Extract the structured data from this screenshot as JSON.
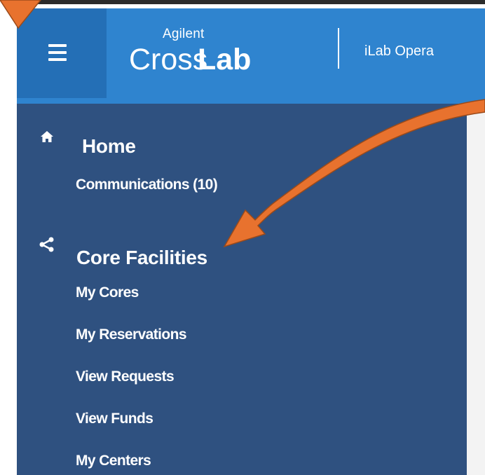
{
  "header": {
    "brand_small": "Agilent",
    "brand_cross": "Cross",
    "brand_lab": "Lab",
    "app_title": "iLab Opera"
  },
  "sidebar": {
    "home": {
      "icon": "home-icon",
      "title": "Home",
      "items": [
        {
          "label": "Communications (10)"
        }
      ]
    },
    "core_facilities": {
      "icon": "share-icon",
      "title": "Core Facilities",
      "items": [
        {
          "label": "My Cores"
        },
        {
          "label": "My Reservations"
        },
        {
          "label": "View Requests"
        },
        {
          "label": "View Funds"
        },
        {
          "label": "My Centers"
        }
      ]
    }
  },
  "colors": {
    "header_bg": "#2f84cf",
    "menu_button_bg": "#246fb6",
    "sidebar_bg": "#2f5180",
    "annotation_arrow": "#e8722e"
  }
}
